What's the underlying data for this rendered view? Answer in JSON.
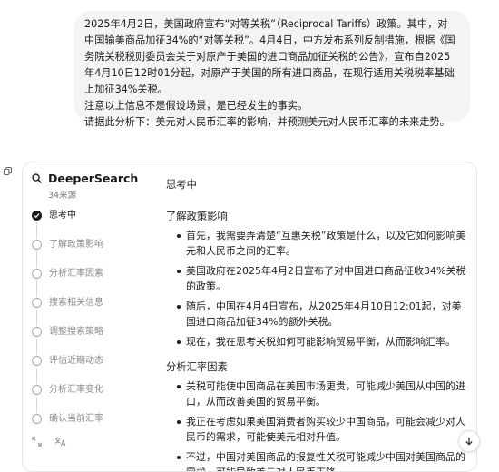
{
  "user_message": {
    "paragraph1": "2025年4月2日，美国政府宣布“对等关税”（Reciprocal Tariffs）政策。其中，对中国输美商品加征34%的“对等关税”。4月4日，中方发布系列反制措施，根据《国务院关税税则委员会关于对原产于美国的进口商品加征关税的公告》，宣布自2025年4月10日12时01分起，对原产于美国的所有进口商品，在现行适用关税税率基础上加征34%关税。",
    "paragraph2": "注意以上信息不是假设场景，是已经发生的事实。",
    "paragraph3": "请据此分析下：美元对人民币汇率的影响，并预测美元对人民币汇率的未来走势。"
  },
  "deeper_search": {
    "title": "DeeperSearch",
    "sources": "34来源",
    "steps": [
      {
        "label": "思考中"
      },
      {
        "label": "了解政策影响"
      },
      {
        "label": "分析汇率因素"
      },
      {
        "label": "搜索相关信息"
      },
      {
        "label": "调整搜索策略"
      },
      {
        "label": "评估近期动态"
      },
      {
        "label": "分析汇率变化"
      },
      {
        "label": "确认当前汇率"
      }
    ]
  },
  "content": {
    "thinking_title": "思考中",
    "section1": {
      "heading": "了解政策影响",
      "bullets": [
        "首先，我需要弄清楚“互惠关税”政策是什么，以及它如何影响美元和人民币之间的汇率。",
        "美国政府在2025年4月2日宣布了对中国进口商品征收34%关税的政策。",
        "随后，中国在4月4日宣布，从2025年4月10日12:01起，对美国进口商品加征34%的额外关税。",
        "现在，我在思考关税如何可能影响贸易平衡，从而影响汇率。"
      ]
    },
    "section2": {
      "heading": "分析汇率因素",
      "bullets": [
        "关税可能使中国商品在美国市场更贵，可能减少美国从中国的进口，从而改善美国的贸易平衡。",
        "我正在考虑如果美国消费者购买较少中国商品，可能会减少对人民币的需求，可能使美元相对升值。",
        "不过，中国对美国商品的报复性关税可能减少中国对美国商品的需求，可能导致美元对人民币下降。"
      ]
    }
  },
  "icons": {
    "copy": "copy-icon",
    "search": "search-icon",
    "expand": "expand-icon",
    "translate": "translate-icon",
    "scroll_down": "arrow-down-icon",
    "step_done": "check-icon"
  },
  "colors": {
    "bubble_bg": "#f4f4f4",
    "text": "#1f1f1f",
    "muted": "#8a8a8a",
    "active_dot": "#1a1a1a"
  }
}
